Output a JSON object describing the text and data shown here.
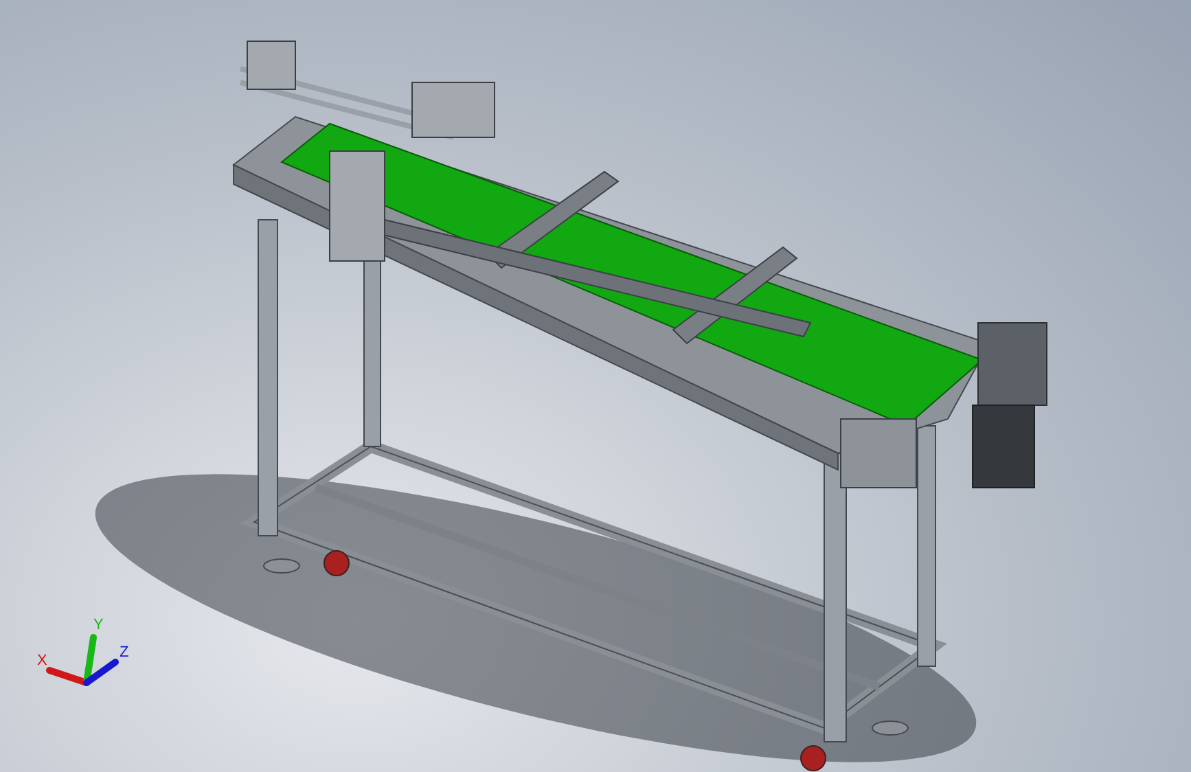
{
  "viewport": {
    "triad": {
      "axes": [
        {
          "label": "X",
          "color": "#d01818"
        },
        {
          "label": "Y",
          "color": "#18b818"
        },
        {
          "label": "Z",
          "color": "#1818d0"
        }
      ]
    }
  }
}
